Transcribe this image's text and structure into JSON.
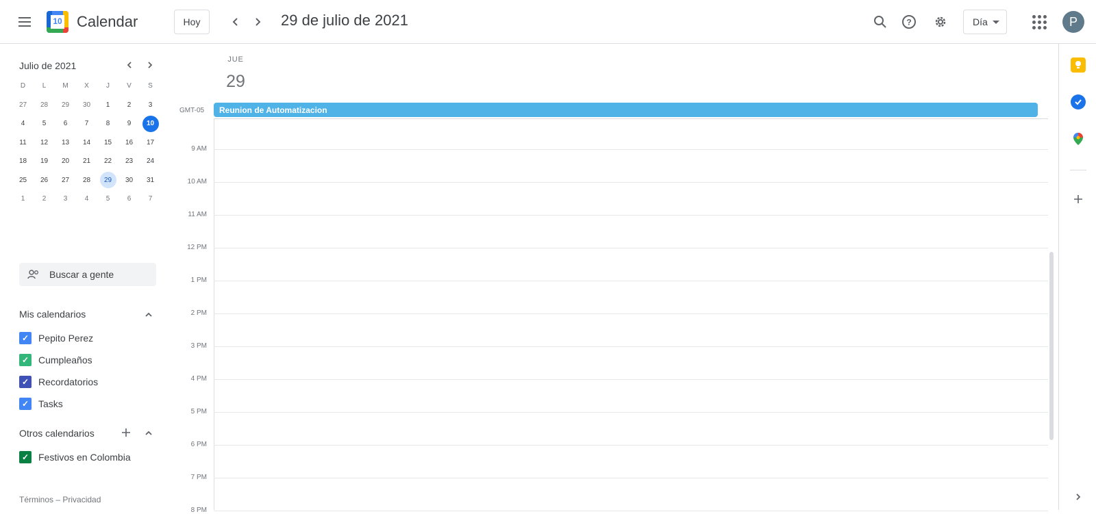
{
  "header": {
    "menu_icon": "hamburger-menu-icon",
    "logo_number": "10",
    "app_title": "Calendar",
    "today_label": "Hoy",
    "date_title": "29 de julio de 2021",
    "view_label": "Día",
    "avatar_initial": "P"
  },
  "mini_calendar": {
    "title": "Julio de 2021",
    "days_of_week": [
      "D",
      "L",
      "M",
      "X",
      "J",
      "V",
      "S"
    ],
    "weeks": [
      [
        "27",
        "28",
        "29",
        "30",
        "1",
        "2",
        "3"
      ],
      [
        "4",
        "5",
        "6",
        "7",
        "8",
        "9",
        "10"
      ],
      [
        "11",
        "12",
        "13",
        "14",
        "15",
        "16",
        "17"
      ],
      [
        "18",
        "19",
        "20",
        "21",
        "22",
        "23",
        "24"
      ],
      [
        "25",
        "26",
        "27",
        "28",
        "29",
        "30",
        "31"
      ],
      [
        "1",
        "2",
        "3",
        "4",
        "5",
        "6",
        "7"
      ]
    ],
    "today": "10",
    "selected": "29"
  },
  "sidebar": {
    "search_people_placeholder": "Buscar a gente",
    "my_calendars_title": "Mis calendarios",
    "my_calendars": [
      {
        "label": "Pepito Perez",
        "color": "#4285f4"
      },
      {
        "label": "Cumpleaños",
        "color": "#33b679"
      },
      {
        "label": "Recordatorios",
        "color": "#3f51b5"
      },
      {
        "label": "Tasks",
        "color": "#4285f4"
      }
    ],
    "other_calendars_title": "Otros calendarios",
    "other_calendars": [
      {
        "label": "Festivos en Colombia",
        "color": "#0b8043"
      }
    ],
    "footer": "Términos – Privacidad"
  },
  "day_view": {
    "day_of_week": "JUE",
    "day_number": "29",
    "timezone": "GMT-05",
    "all_day_event": "Reunion de Automatizacion",
    "hours": [
      "9 AM",
      "10 AM",
      "11 AM",
      "12 PM",
      "1 PM",
      "2 PM",
      "3 PM",
      "4 PM",
      "5 PM",
      "6 PM",
      "7 PM",
      "8 PM"
    ]
  },
  "colors": {
    "accent": "#1a73e8",
    "event": "#4fb3e8"
  }
}
